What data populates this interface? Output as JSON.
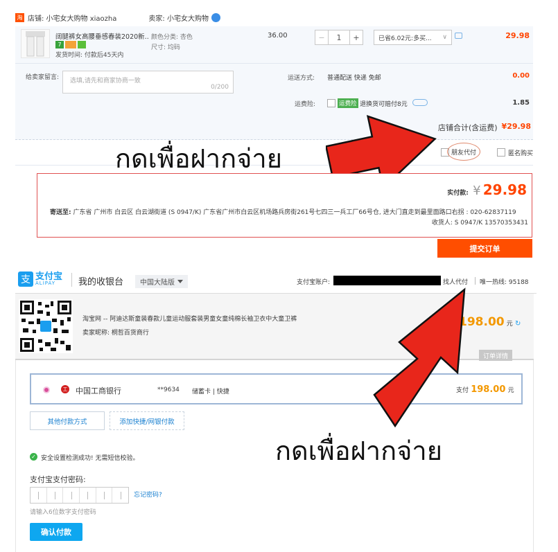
{
  "shop": {
    "store_label": "店铺: 小宅女大购物 xiaozha",
    "seller_label": "卖家: 小宅女大购物",
    "logo_text": "淘"
  },
  "item": {
    "title": "阔腿裤女高腰垂感春装2020新...",
    "ship_time": "发货时间: 付款后45天内",
    "color": "颜色分类: 杏色",
    "size": "尺寸: 均码",
    "unit_price": "36.00",
    "qty_minus": "−",
    "qty_value": "1",
    "qty_plus": "+",
    "discount_select": "已省6.02元:多买...",
    "subtotal": "29.98",
    "badges": [
      "7",
      "",
      ""
    ]
  },
  "message": {
    "label": "给卖家留言:",
    "placeholder": "选填,请先和商家协商一致",
    "counter": "0/200"
  },
  "delivery": {
    "label": "运送方式:",
    "value": "普通配送 快递 免邮",
    "price": "0.00"
  },
  "insurance": {
    "label": "运费险:",
    "tag": "运费险",
    "text": "退换货可赔付8元",
    "price": "1.85"
  },
  "store_total": {
    "label": "店铺合计(含运费)",
    "value": "¥29.98"
  },
  "pay_options": {
    "friend_pay": "朋友代付",
    "anonymous": "匿名购买"
  },
  "thai_caption_top": "กดเพื่อฝากจ่าย",
  "summary": {
    "actual_label": "实付款:",
    "currency": "¥",
    "amount": "29.98",
    "address_label": "寄送至:",
    "address": "广东省 广州市 白云区 白云湖街道 (S 0947/K) 广东省广州市白云区机场路兵房街261号七四三一兵工厂66号仓, 进大门直走到最里面路口右拐 : 020-62837119",
    "receiver": "收货人: S 0947/K 13570353431"
  },
  "submit_label": "提交订单",
  "alipay": {
    "logo_cn": "支付宝",
    "logo_en": "ALIPAY",
    "cashier": "我的收银台",
    "region": "中国大陆版",
    "account_label": "支付宝账户:",
    "find_pay": "找人代付",
    "hotline": "唯一热线: 95188",
    "order_title": "淘宝网 -- 阿迪达斯童装春款儿童运动服套装男童女童纯棉长袖卫衣中大童卫裤",
    "seller_nick": "卖家昵称: 桐哲百货商行",
    "amount": "198.00",
    "amount_unit": "元",
    "order_detail": "订单详情",
    "bank_name": "中国工商银行",
    "card_no": "**9634",
    "card_type": "储蓄卡 | 快捷",
    "pay_label": "支付",
    "pay_amount": "198.00",
    "pay_unit": "元",
    "other_methods": "其他付款方式",
    "add_card": "添加快捷/网银付款",
    "security_ok": "安全设置检测成功! 无需短信校验。",
    "pwd_label": "支付宝支付密码:",
    "forgot": "忘记密码?",
    "pwd_hint": "请输入6位数字支付密码",
    "confirm": "确认付款"
  },
  "thai_caption_bottom": "กดเพื่อฝากจ่าย",
  "colors": {
    "accent": "#ff4400",
    "alipay_blue": "#1a9eef",
    "arrow_red": "#e8261b",
    "confirm_blue": "#0ea7f0"
  }
}
